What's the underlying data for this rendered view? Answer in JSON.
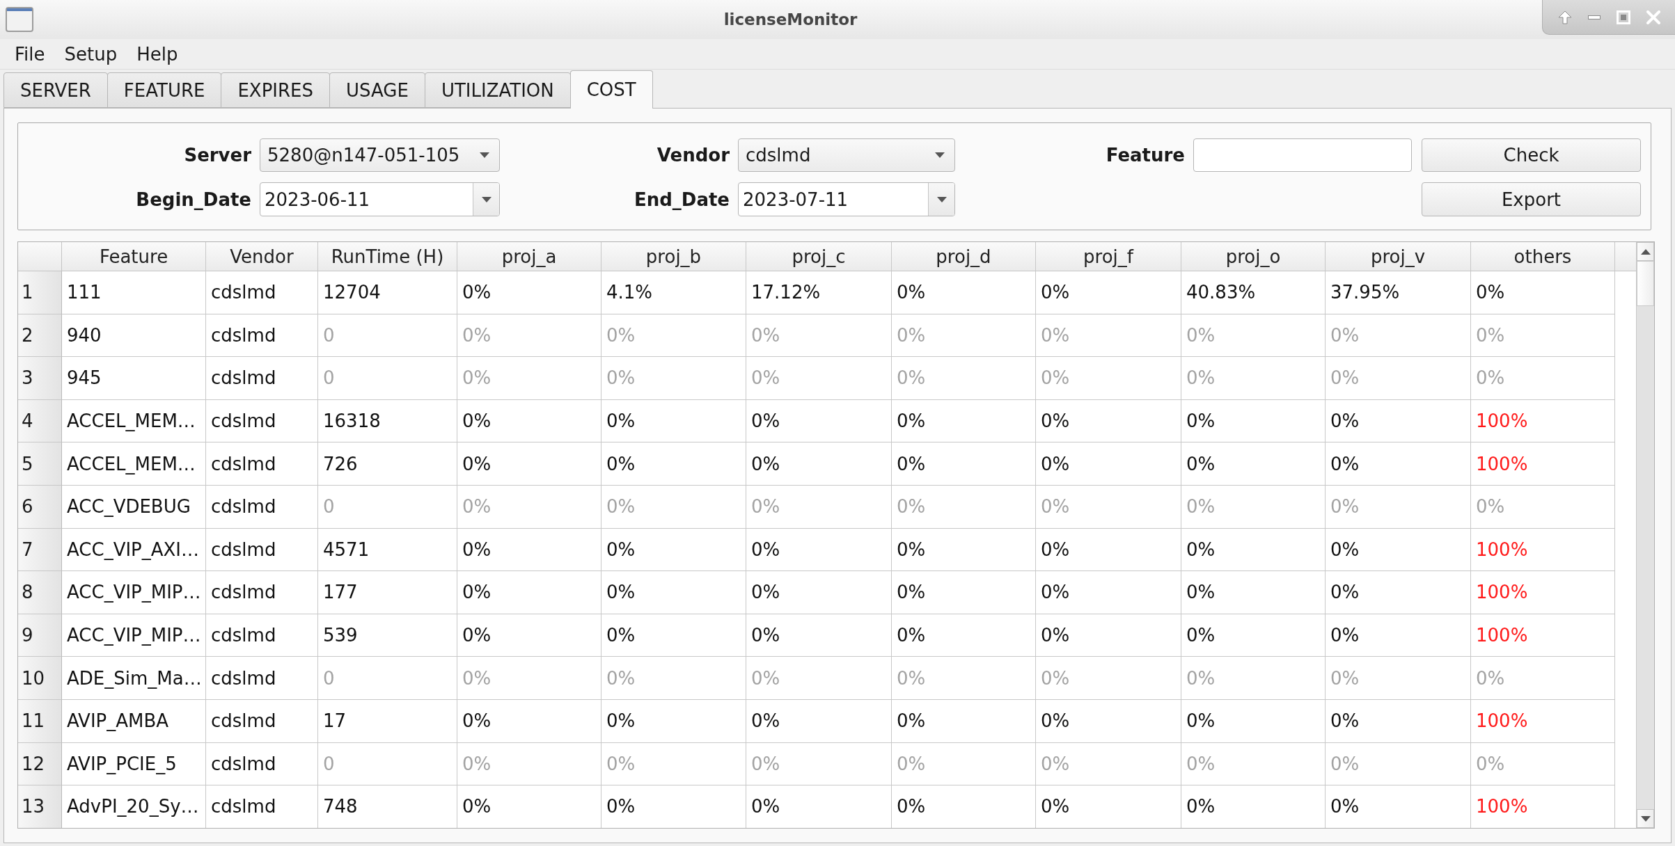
{
  "window": {
    "title": "licenseMonitor"
  },
  "menu": [
    "File",
    "Setup",
    "Help"
  ],
  "tabs": [
    {
      "label": "SERVER",
      "selected": false
    },
    {
      "label": "FEATURE",
      "selected": false
    },
    {
      "label": "EXPIRES",
      "selected": false
    },
    {
      "label": "USAGE",
      "selected": false
    },
    {
      "label": "UTILIZATION",
      "selected": false
    },
    {
      "label": "COST",
      "selected": true
    }
  ],
  "filter_panel": {
    "rows": [
      {
        "fields": [
          {
            "kind": "dropdown",
            "label": "Server",
            "value": "5280@n147-051-105"
          },
          {
            "kind": "dropdown",
            "label": "Vendor",
            "value": "cdslmd"
          },
          {
            "kind": "text",
            "label": "Feature"
          }
        ],
        "button": "Check"
      },
      {
        "fields": [
          {
            "kind": "date",
            "label": "Begin_Date",
            "value": "2023-06-11"
          },
          {
            "kind": "date",
            "label": "End_Date",
            "value": "2023-07-11"
          }
        ],
        "button": "Export"
      }
    ]
  },
  "table": {
    "columns": [
      "Feature",
      "Vendor",
      "RunTime (H)",
      "proj_a",
      "proj_b",
      "proj_c",
      "proj_d",
      "proj_f",
      "proj_o",
      "proj_v",
      "others"
    ],
    "rows": [
      {
        "number": "1",
        "cells": [
          "111",
          "cdslmd",
          "12704",
          "0%",
          "4.1%",
          "17.12%",
          "0%",
          "0%",
          "40.83%",
          "37.95%",
          "0%"
        ],
        "inactive": false,
        "others_alert": false
      },
      {
        "number": "2",
        "cells": [
          "940",
          "cdslmd",
          "0",
          "0%",
          "0%",
          "0%",
          "0%",
          "0%",
          "0%",
          "0%",
          "0%"
        ],
        "inactive": true,
        "others_alert": false
      },
      {
        "number": "3",
        "cells": [
          "945",
          "cdslmd",
          "0",
          "0%",
          "0%",
          "0%",
          "0%",
          "0%",
          "0%",
          "0%",
          "0%"
        ],
        "inactive": true,
        "others_alert": false
      },
      {
        "number": "4",
        "cells": [
          "ACCEL_MEM…",
          "cdslmd",
          "16318",
          "0%",
          "0%",
          "0%",
          "0%",
          "0%",
          "0%",
          "0%",
          "100%"
        ],
        "inactive": false,
        "others_alert": true
      },
      {
        "number": "5",
        "cells": [
          "ACCEL_MEM…",
          "cdslmd",
          "726",
          "0%",
          "0%",
          "0%",
          "0%",
          "0%",
          "0%",
          "0%",
          "100%"
        ],
        "inactive": false,
        "others_alert": true
      },
      {
        "number": "6",
        "cells": [
          "ACC_VDEBUG",
          "cdslmd",
          "0",
          "0%",
          "0%",
          "0%",
          "0%",
          "0%",
          "0%",
          "0%",
          "0%"
        ],
        "inactive": true,
        "others_alert": false
      },
      {
        "number": "7",
        "cells": [
          "ACC_VIP_AXI…",
          "cdslmd",
          "4571",
          "0%",
          "0%",
          "0%",
          "0%",
          "0%",
          "0%",
          "0%",
          "100%"
        ],
        "inactive": false,
        "others_alert": true
      },
      {
        "number": "8",
        "cells": [
          "ACC_VIP_MIP…",
          "cdslmd",
          "177",
          "0%",
          "0%",
          "0%",
          "0%",
          "0%",
          "0%",
          "0%",
          "100%"
        ],
        "inactive": false,
        "others_alert": true
      },
      {
        "number": "9",
        "cells": [
          "ACC_VIP_MIP…",
          "cdslmd",
          "539",
          "0%",
          "0%",
          "0%",
          "0%",
          "0%",
          "0%",
          "0%",
          "100%"
        ],
        "inactive": false,
        "others_alert": true
      },
      {
        "number": "10",
        "cells": [
          "ADE_Sim_Ma…",
          "cdslmd",
          "0",
          "0%",
          "0%",
          "0%",
          "0%",
          "0%",
          "0%",
          "0%",
          "0%"
        ],
        "inactive": true,
        "others_alert": false
      },
      {
        "number": "11",
        "cells": [
          "AVIP_AMBA",
          "cdslmd",
          "17",
          "0%",
          "0%",
          "0%",
          "0%",
          "0%",
          "0%",
          "0%",
          "100%"
        ],
        "inactive": false,
        "others_alert": true
      },
      {
        "number": "12",
        "cells": [
          "AVIP_PCIE_5",
          "cdslmd",
          "0",
          "0%",
          "0%",
          "0%",
          "0%",
          "0%",
          "0%",
          "0%",
          "0%"
        ],
        "inactive": true,
        "others_alert": false
      },
      {
        "number": "13",
        "cells": [
          "AdvPI_20_Sy…",
          "cdslmd",
          "748",
          "0%",
          "0%",
          "0%",
          "0%",
          "0%",
          "0%",
          "0%",
          "100%"
        ],
        "inactive": false,
        "others_alert": true
      }
    ]
  }
}
